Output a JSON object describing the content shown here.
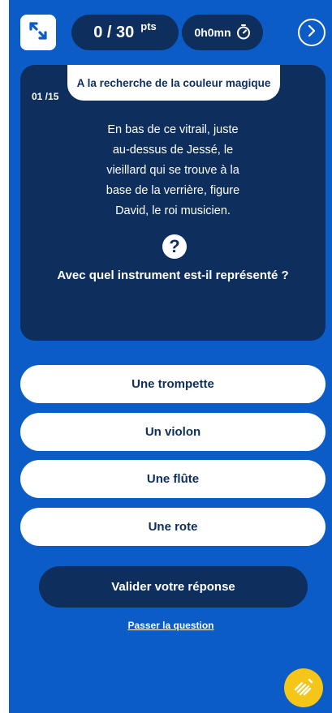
{
  "header": {
    "score": "0 / 30",
    "score_unit": "pts",
    "timer": "0h0mn",
    "icons": {
      "expand": "expand-arrows-icon",
      "timer": "stopwatch-icon",
      "next": "chevron-right-icon"
    }
  },
  "card": {
    "title": "A la recherche de la couleur magique",
    "counter": "01 /15",
    "text": "En bas de ce vitrail, juste\nau-dessus de Jessé, le\nvieillard qui se trouve à la\nbase de la verrière, figure\nDavid, le roi musicien.",
    "help_icon": "?",
    "question": "Avec quel instrument est-il représenté ?"
  },
  "answers": [
    {
      "label": "Une trompette"
    },
    {
      "label": "Un violon"
    },
    {
      "label": "Une flûte"
    },
    {
      "label": "Une rote"
    }
  ],
  "actions": {
    "validate": "Valider votre réponse",
    "skip": "Passer la question"
  },
  "colors": {
    "primary": "#0b5cc6",
    "dark": "#0e2f5e",
    "accent": "#f5c518"
  }
}
